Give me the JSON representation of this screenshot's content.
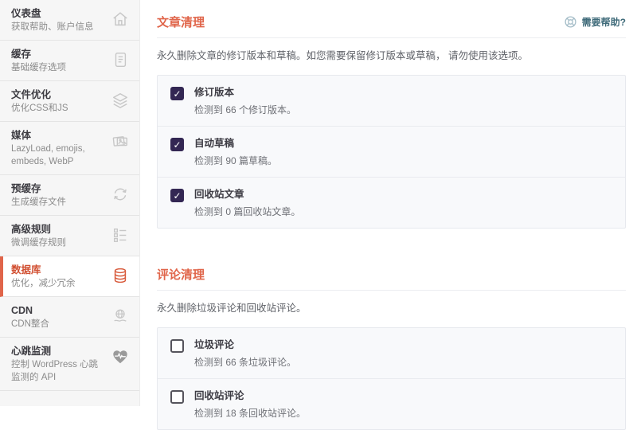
{
  "colors": {
    "accent_orange": "#e0654a",
    "active_item_orange": "#d14f31",
    "checkbox_purple": "#332753",
    "help_teal": "#3f6b7a",
    "sidebar_bg": "#f6f6f6",
    "panel_bg": "#f8f9fb"
  },
  "sidebar": {
    "items": [
      {
        "title": "仪表盘",
        "subtitle": "获取帮助、账户信息",
        "icon": "home-icon",
        "active": false
      },
      {
        "title": "缓存",
        "subtitle": "基础缓存选项",
        "icon": "file-icon",
        "active": false
      },
      {
        "title": "文件优化",
        "subtitle": "优化CSS和JS",
        "icon": "layers-icon",
        "active": false
      },
      {
        "title": "媒体",
        "subtitle": "LazyLoad, emojis, embeds, WebP",
        "icon": "media-icon",
        "active": false
      },
      {
        "title": "预缓存",
        "subtitle": "生成缓存文件",
        "icon": "refresh-icon",
        "active": false
      },
      {
        "title": "高级规则",
        "subtitle": "微调缓存规则",
        "icon": "checklist-icon",
        "active": false
      },
      {
        "title": "数据库",
        "subtitle": "优化，减少冗余",
        "icon": "database-icon",
        "active": true
      },
      {
        "title": "CDN",
        "subtitle": "CDN整合",
        "icon": "cdn-icon",
        "active": false
      },
      {
        "title": "心跳监测",
        "subtitle": "控制 WordPress 心跳监测的 API",
        "icon": "heartbeat-icon",
        "active": false
      }
    ]
  },
  "main": {
    "help_link_label": "需要帮助?",
    "checkmark_glyph": "✓",
    "sections": [
      {
        "title": "文章清理",
        "description": "永久删除文章的修订版本和草稿。如您需要保留修订版本或草稿， 请勿使用该选项。",
        "options": [
          {
            "label": "修订版本",
            "detail": "检测到 66 个修订版本。",
            "checked": true
          },
          {
            "label": "自动草稿",
            "detail": "检测到 90 篇草稿。",
            "checked": true
          },
          {
            "label": "回收站文章",
            "detail": "检测到 0 篇回收站文章。",
            "checked": true
          }
        ]
      },
      {
        "title": "评论清理",
        "description": "永久删除垃圾评论和回收站评论。",
        "options": [
          {
            "label": "垃圾评论",
            "detail": "检测到 66 条垃圾评论。",
            "checked": false
          },
          {
            "label": "回收站评论",
            "detail": "检测到 18 条回收站评论。",
            "checked": false
          }
        ]
      }
    ]
  }
}
